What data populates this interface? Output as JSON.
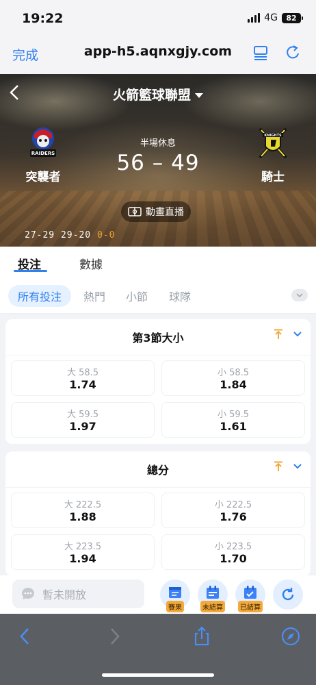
{
  "status_bar": {
    "time": "19:22",
    "network": "4G",
    "battery": "82"
  },
  "browser": {
    "done_label": "完成",
    "url": "app-h5.aqnxgjy.com",
    "tabs_icon": "tabs-icon",
    "reload_icon": "reload-icon"
  },
  "match": {
    "league": "火箭籃球聯盟",
    "home_team": "突襲者",
    "home_logo_text": "RAIDERS",
    "away_team": "騎士",
    "away_logo_text": "KNIGHTS",
    "status": "半場休息",
    "score": "56 – 49",
    "animation_label": "動畫直播",
    "quarters": {
      "q1": "27-29",
      "q2": "29-20",
      "q3": "0-0"
    }
  },
  "tabs": {
    "bet": "投注",
    "data": "數據"
  },
  "filters": {
    "all": "所有投注",
    "hot": "熱門",
    "quarter": "小節",
    "team": "球隊"
  },
  "markets": [
    {
      "title": "第3節大小",
      "rows": [
        [
          {
            "label": "大 58.5",
            "odds": "1.74"
          },
          {
            "label": "小 58.5",
            "odds": "1.84"
          }
        ],
        [
          {
            "label": "大 59.5",
            "odds": "1.97"
          },
          {
            "label": "小 59.5",
            "odds": "1.61"
          }
        ]
      ]
    },
    {
      "title": "總分",
      "rows": [
        [
          {
            "label": "大 222.5",
            "odds": "1.88"
          },
          {
            "label": "小 222.5",
            "odds": "1.76"
          }
        ],
        [
          {
            "label": "大 223.5",
            "odds": "1.94"
          },
          {
            "label": "小 223.5",
            "odds": "1.70"
          }
        ]
      ]
    }
  ],
  "action_bar": {
    "chat_placeholder": "暫未開放",
    "results": "賽果",
    "unsettled": "未結算",
    "settled": "已結算"
  },
  "colors": {
    "accent": "#2f7ff0",
    "live": "#f2a33a",
    "badge": "#f3a93b"
  }
}
